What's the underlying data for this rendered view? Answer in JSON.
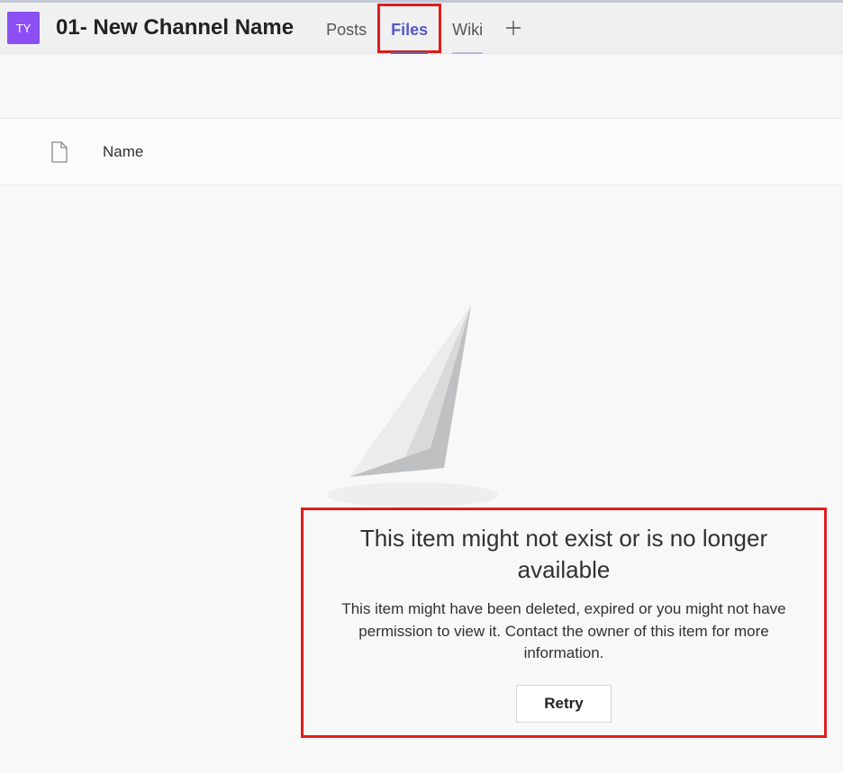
{
  "header": {
    "team_initials": "TY",
    "channel_name": "01- New Channel Name"
  },
  "tabs": {
    "posts": "Posts",
    "files": "Files",
    "wiki": "Wiki"
  },
  "columns": {
    "name": "Name"
  },
  "error": {
    "title": "This item might not exist or is no longer available",
    "description": "This item might have been deleted, expired or you might not have permission to view it. Contact the owner of this item for more information.",
    "retry_label": "Retry"
  }
}
